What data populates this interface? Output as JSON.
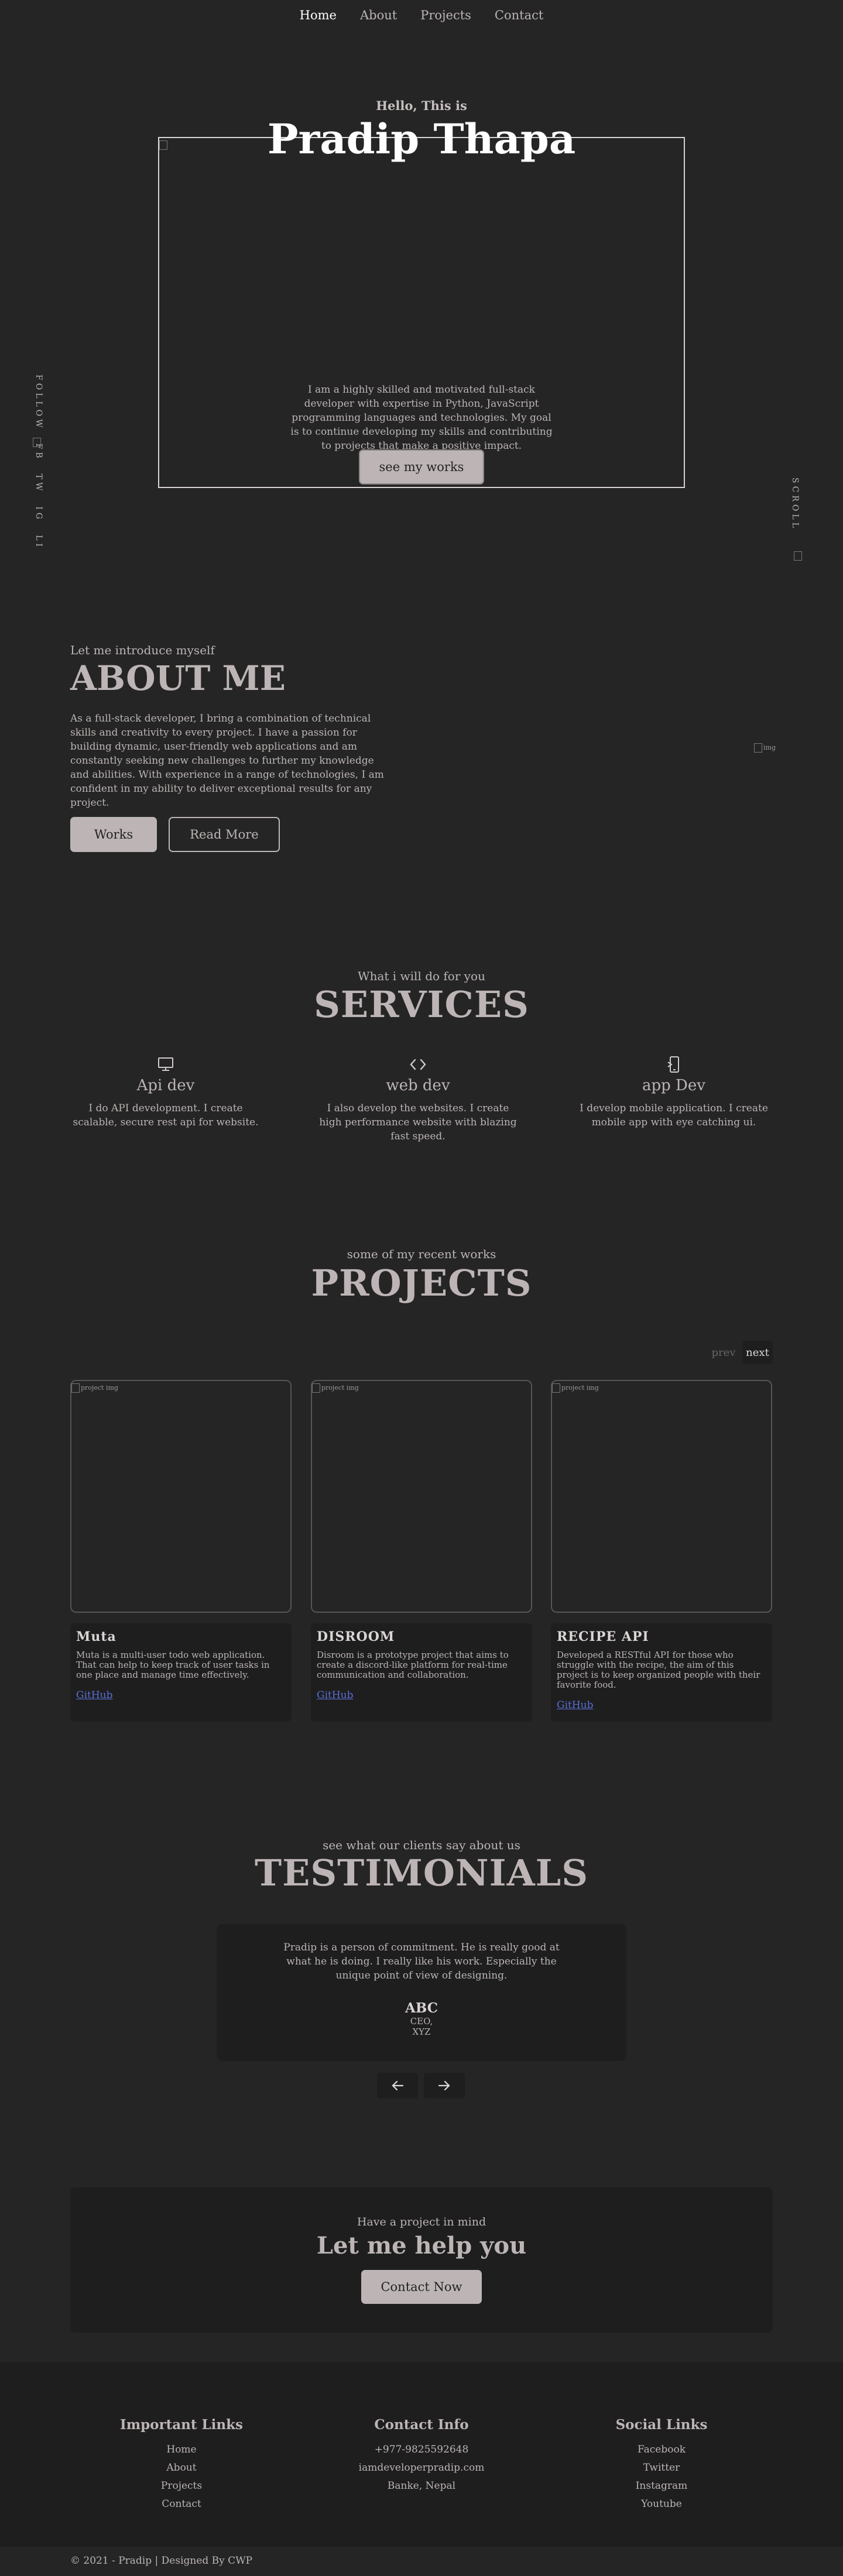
{
  "nav": {
    "items": [
      "Home",
      "About",
      "Projects",
      "Contact"
    ],
    "active": "Home"
  },
  "hero": {
    "kicker": "Hello, This is",
    "title": "Pradip Thapa",
    "image_alt": "",
    "bio": "I am a highly skilled and motivated full-stack developer with expertise in Python, JavaScript programming languages and technologies. My goal is to continue developing my skills and contributing to projects that make a positive impact.",
    "button": "see my works",
    "follow": [
      "FOLLOW",
      "FB",
      "TW",
      "IG",
      "LI"
    ],
    "follow_img_alt": "",
    "scroll": "SCROLL",
    "scroll_img_alt": ""
  },
  "about": {
    "kicker": "Let me introduce myself",
    "title": "ABOUT ME",
    "text": "As a full-stack developer, I bring a combination of technical skills and creativity to every project. I have a passion for building dynamic, user-friendly web applications and am constantly seeking new challenges to further my knowledge and abilities. With experience in a range of technologies, I am confident in my ability to deliver exceptional results for any project.",
    "button_works": "Works",
    "button_read": "Read More",
    "image_alt": "img"
  },
  "services": {
    "kicker": "What i will do for you",
    "title": "SERVICES",
    "items": [
      {
        "icon": "monitor-icon",
        "name": "Api dev",
        "desc": "I do API development. I create scalable, secure rest api for website."
      },
      {
        "icon": "code-icon",
        "name": "web dev",
        "desc": "I also develop the websites. I create high performance website with blazing fast speed."
      },
      {
        "icon": "mobile-icon",
        "name": "app Dev",
        "desc": "I develop mobile application. I create mobile app with eye catching ui."
      }
    ]
  },
  "projects": {
    "kicker": "some of my recent works",
    "title": "PROJECTS",
    "prev": "prev",
    "next": "next",
    "image_alt": "project img",
    "items": [
      {
        "title": "Muta",
        "desc": "Muta is a multi-user todo web application. That can help to keep track of user tasks in one place and manage time effectively.",
        "link": "GitHub"
      },
      {
        "title": "DISROOM",
        "desc": "Disroom is a prototype project that aims to create a discord-like platform for real-time communication and collaboration.",
        "link": "GitHub"
      },
      {
        "title": "RECIPE API",
        "desc": "Developed a RESTful API for those who struggle with the recipe, the aim of this project is to keep organized people with their favorite food.",
        "link": "GitHub"
      }
    ]
  },
  "testimonials": {
    "kicker": "see what our clients say about us",
    "title": "TESTIMONIALS",
    "quote": "Pradip is a person of commitment. He is really good at what he is doing. I really like his work. Especially the unique point of view of designing.",
    "name": "ABC",
    "role": "CEO,",
    "company": "XYZ"
  },
  "cta": {
    "kicker": "Have a project in mind",
    "title": "Let me help you",
    "button": "Contact Now"
  },
  "footer": {
    "columns": [
      {
        "heading": "Important Links",
        "links": [
          "Home",
          "About",
          "Projects",
          "Contact"
        ]
      },
      {
        "heading": "Contact Info",
        "links": [
          "+977-9825592648",
          "iamdeveloperpradip.com",
          "Banke, Nepal"
        ]
      },
      {
        "heading": "Social Links",
        "links": [
          "Facebook",
          "Twitter",
          "Instagram",
          "Youtube"
        ]
      }
    ],
    "copyright": "© 2021 - Pradip | Designed By CWP"
  },
  "colors": {
    "background": "#252525",
    "panel": "#1e1e1e",
    "text": "#bdb5b5",
    "accent_button": "#bdb5b5",
    "link": "#5a6fd6"
  }
}
